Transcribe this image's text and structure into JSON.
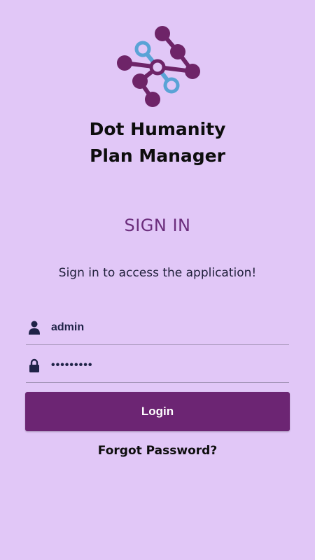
{
  "app": {
    "title_line1": "Dot Humanity",
    "title_line2": "Plan Manager",
    "logo_icon": "network-nodes-logo"
  },
  "signin": {
    "heading": "SIGN IN",
    "subtitle": "Sign in to access the application!"
  },
  "form": {
    "username": {
      "value": "admin",
      "icon": "user-icon"
    },
    "password": {
      "value": "•••••••••",
      "icon": "lock-icon"
    },
    "login_label": "Login",
    "forgot_label": "Forgot Password?"
  },
  "colors": {
    "background": "#e1c7f7",
    "brand_purple": "#6c2573",
    "heading_purple": "#6b2d7c",
    "logo_dark": "#6e2468",
    "logo_blue": "#5aa3d6",
    "icon_navy": "#1f2347"
  }
}
